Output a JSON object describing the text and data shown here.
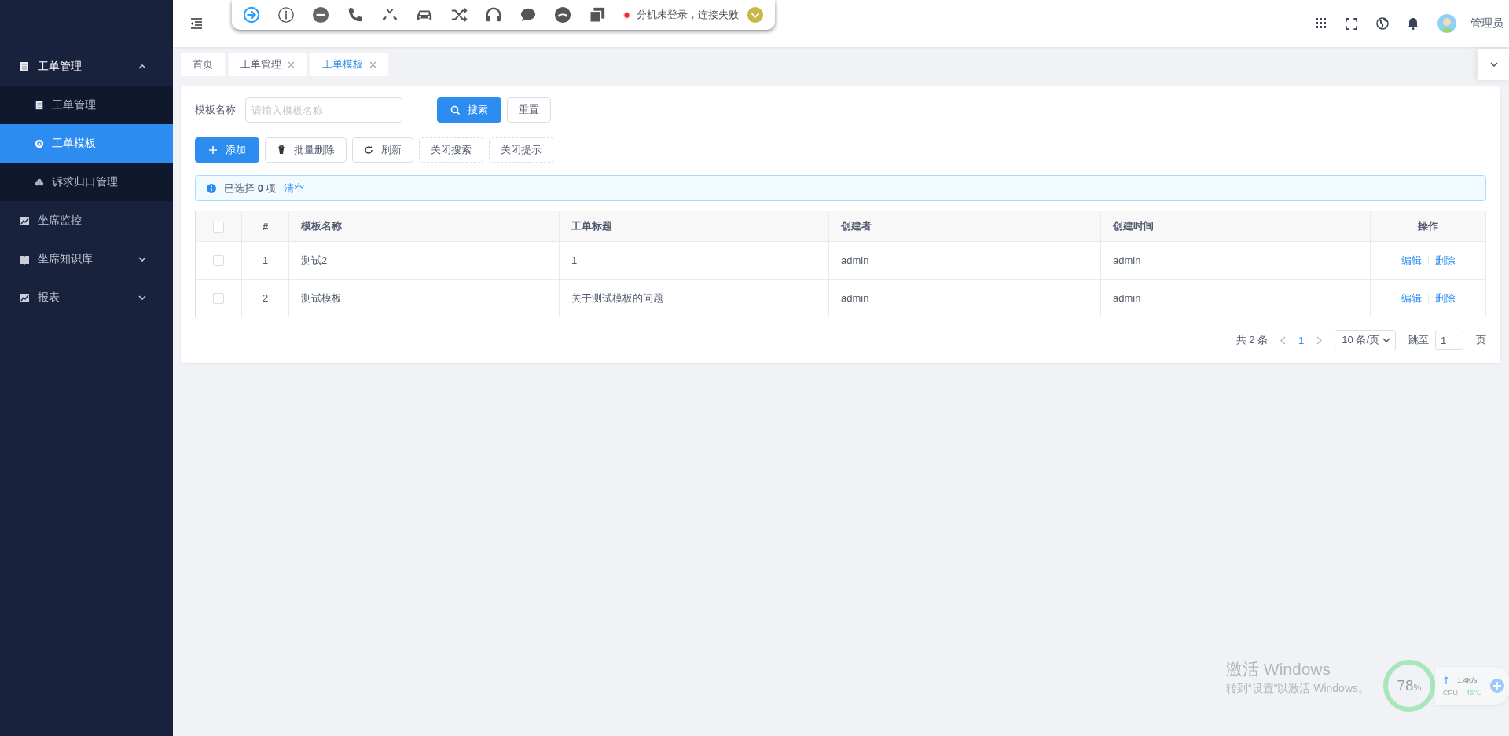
{
  "toolbar": {
    "status": "分机未登录，连接失败"
  },
  "header": {
    "user": "管理员"
  },
  "sidebar": {
    "items": [
      {
        "label": "工单管理",
        "selected": false,
        "expanded": true,
        "children": [
          {
            "label": "工单管理",
            "selected": false
          },
          {
            "label": "工单模板",
            "selected": true
          },
          {
            "label": "诉求归口管理",
            "selected": false
          }
        ]
      },
      {
        "label": "坐席监控",
        "selected": false
      },
      {
        "label": "坐席知识库",
        "selected": false,
        "expanded": false
      },
      {
        "label": "报表",
        "selected": false,
        "expanded": false
      }
    ]
  },
  "tabs": [
    {
      "label": "首页",
      "selected": false,
      "closable": false
    },
    {
      "label": "工单管理",
      "selected": false,
      "closable": true
    },
    {
      "label": "工单模板",
      "selected": true,
      "closable": true
    }
  ],
  "search": {
    "label": "模板名称",
    "placeholder": "请输入模板名称",
    "buttons": [
      {
        "label": "搜索",
        "kind": "primary"
      },
      {
        "label": "重置",
        "kind": "default"
      }
    ]
  },
  "actions": [
    {
      "label": "添加",
      "kind": "primary"
    },
    {
      "label": "批量删除",
      "kind": "default"
    },
    {
      "label": "刷新",
      "kind": "default"
    },
    {
      "label": "关闭搜索",
      "kind": "dashed"
    },
    {
      "label": "关闭提示",
      "kind": "dashed"
    }
  ],
  "alert": {
    "text": "已选择 **0** 项",
    "link": "清空"
  },
  "table": {
    "header_checked": false,
    "columns": [
      "#",
      "模板名称",
      "工单标题",
      "创建者",
      "创建时间",
      "操作"
    ],
    "rows": [
      {
        "checked": false,
        "cells": [
          "1",
          "测试2",
          "1",
          "admin",
          "admin"
        ],
        "actions": [
          "编辑",
          "删除"
        ]
      },
      {
        "checked": false,
        "cells": [
          "2",
          "测试模板",
          "关于测试模板的问题",
          "admin",
          "admin"
        ],
        "actions": [
          "编辑",
          "删除"
        ]
      }
    ]
  },
  "pagination": {
    "total": "共 2 条",
    "pages": [
      {
        "label": "1",
        "selected": true
      }
    ],
    "page_size": "10 条/页",
    "jump_label": "跳至",
    "jump_value": "1",
    "page_suffix": "页"
  },
  "activation": {
    "title": "激活 Windows",
    "text": "转到“设置”以激活 Windows。"
  },
  "monitor": {
    "percent": "78",
    "unit": "%",
    "net": "1.4K/s",
    "cpu_label": "CPU",
    "cpu_temp": "46℃"
  }
}
